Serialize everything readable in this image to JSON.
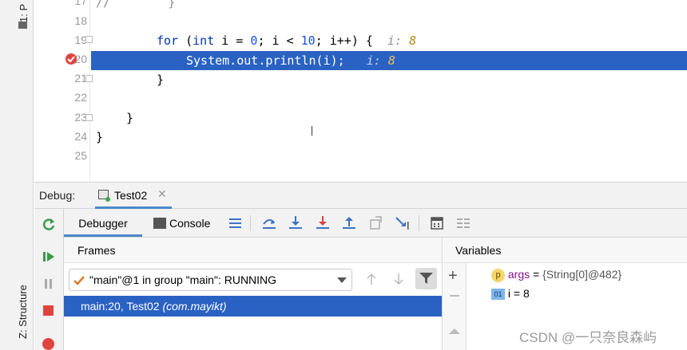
{
  "sidebar": {
    "project_tab": "1: P",
    "structure_tab": "Z: Structure"
  },
  "editor": {
    "line_numbers": [
      "17",
      "18",
      "19",
      "20",
      "21",
      "22",
      "23",
      "24",
      "25"
    ],
    "line17": "//        }",
    "line19": {
      "kw": "for",
      "p1": " (",
      "kw2": "int",
      "p2": " i = ",
      "n1": "0",
      "p3": "; i < ",
      "n2": "10",
      "p4": "; i++) {  ",
      "hint": "i: ",
      "hintval": "8"
    },
    "line20": {
      "code": "System.out.println(i);",
      "hint": "i: ",
      "hintval": "8"
    },
    "line21": "}",
    "line23": "}",
    "line24": "}"
  },
  "debug": {
    "label": "Debug:",
    "session_tab": "Test02",
    "tabs": {
      "debugger": "Debugger",
      "console": "Console"
    },
    "frames_header": "Frames",
    "variables_header": "Variables",
    "thread_select": "\"main\"@1 in group \"main\": RUNNING",
    "frame_row": {
      "location": "main:20, Test02",
      "package": "(com.mayikt)"
    },
    "variables": [
      {
        "icon": "p",
        "name": "args",
        "value": "{String[0]@482}"
      },
      {
        "icon": "01",
        "name": "i",
        "value": "8"
      }
    ]
  },
  "watermark": "CSDN @一只奈良森屿",
  "colors": {
    "selection": "#2962c2",
    "keyword": "#0033b3",
    "number": "#1750eb",
    "hint_value": "#b8860b"
  }
}
